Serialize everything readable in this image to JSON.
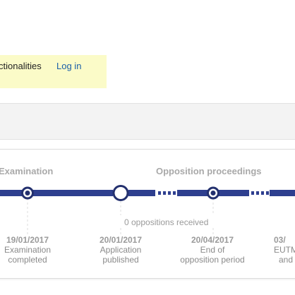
{
  "header": {
    "functionalities_text": "ctionalities",
    "login_label": "Log in"
  },
  "colors": {
    "timeline": "#2e3f8f",
    "login_bar": "#fbfbc8",
    "stage_text": "#a9a9a9"
  },
  "timeline": {
    "stages": [
      {
        "label": "Examination"
      },
      {
        "label": "Opposition proceedings"
      }
    ],
    "oppositions_note": "0 oppositions received",
    "events": [
      {
        "date": "19/01/2017",
        "line1": "Examination",
        "line2": "completed"
      },
      {
        "date": "20/01/2017",
        "line1": "Application",
        "line2": "published"
      },
      {
        "date": "20/04/2017",
        "line1": "End of",
        "line2": "opposition period"
      },
      {
        "date": "03/",
        "line1": "EUTM",
        "line2": "and"
      }
    ]
  }
}
